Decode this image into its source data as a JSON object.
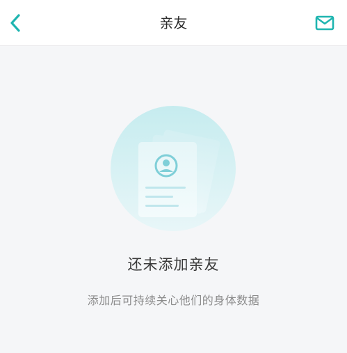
{
  "header": {
    "title": "亲友",
    "back_icon": "chevron-left-icon",
    "mail_icon": "mail-icon",
    "accent_color": "#1fb5b0"
  },
  "empty_state": {
    "illustration": "contact-cards-illustration",
    "title": "还未添加亲友",
    "description": "添加后可持续关心他们的身体数据"
  }
}
